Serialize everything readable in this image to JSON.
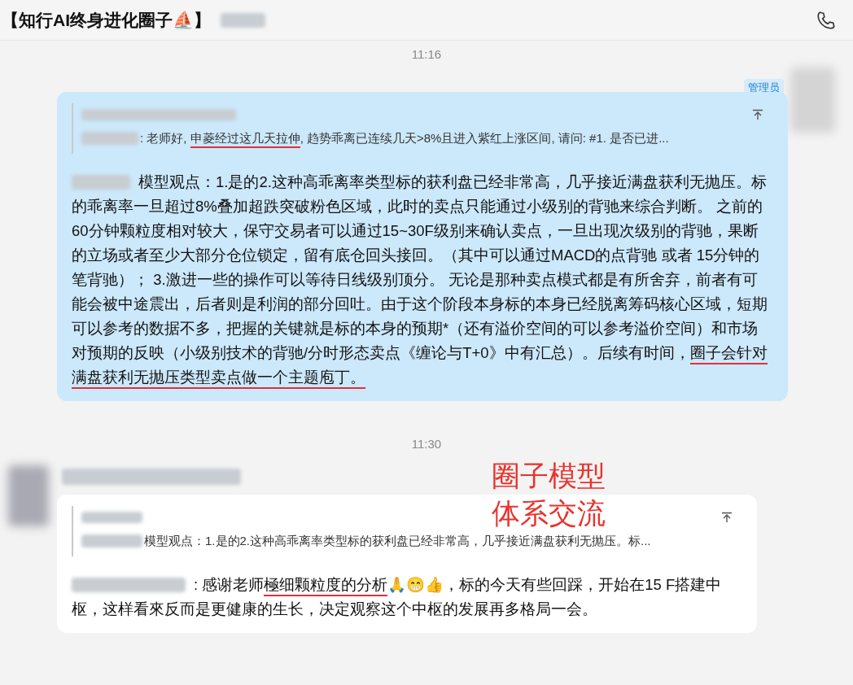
{
  "header": {
    "title": "【知行AI终身进化圈子⛵】"
  },
  "annotation": [
    "圈子模型",
    "体系交流"
  ],
  "messages": [
    {
      "time": "11:16",
      "kind": "sent",
      "badge": "管理员",
      "quote": [
        {
          "text": ": 老师好, ",
          "underlined": false
        },
        {
          "text": "申菱经过这几天拉伸",
          "underlined": true
        },
        {
          "text": ", 趋势乖离已连续几天>8%且进入紫红上涨区间, 请问: #1. 是否已进...",
          "underlined": false
        }
      ],
      "body": [
        {
          "text": "模型观点：1.是的2.这种高乖离率类型标的获利盘已经非常高，几乎接近满盘获利无抛压。标的乖离率一旦超过8%叠加超跌突破粉色区域，此时的卖点只能通过小级别的背驰来综合判断。 之前的60分钟颗粒度相对较大，保守交易者可以通过15~30F级别来确认卖点，一旦出现次级别的背驰，果断的立场或者至少大部分仓位锁定，留有底仓回头接回。（其中可以通过MACD的点背驰 或者 15分钟的笔背驰）； 3.激进一些的操作可以等待日线级别顶分。 无论是那种卖点模式都是有所舍弃，前者有可能会被中途震出，后者则是利润的部分回吐。由于这个阶段本身标的本身已经脱离筹码核心区域，短期可以参考的数据不多，把握的关键就是标的本身的预期*（还有溢价空间的可以参考溢价空间）和市场对预期的反映（小级别技术的背驰/分时形态卖点《缠论与T+0》中有汇总）。后续有时间，",
          "underlined": false
        },
        {
          "text": "圈子会针对满盘获利无抛压类型卖点做一个主题庖丁。",
          "underlined": true
        }
      ]
    },
    {
      "time": "11:30",
      "kind": "received",
      "quote": [
        {
          "text": "模型观点：1.是的2.这种高乖离率类型标的获利盘已经非常高，几乎接近满盘获利无抛压。标...",
          "underlined": false
        }
      ],
      "body": [
        {
          "text": ": 感谢老师",
          "underlined": false
        },
        {
          "text": "極细颗粒度的分析",
          "underlined": true
        },
        {
          "text": "🙏😁👍，标的今天有些回踩，开始在15 F搭建中枢，这样看來反而是更健康的生长，决定观察这个中枢的发展再多格局一会。",
          "underlined": false
        }
      ]
    }
  ]
}
